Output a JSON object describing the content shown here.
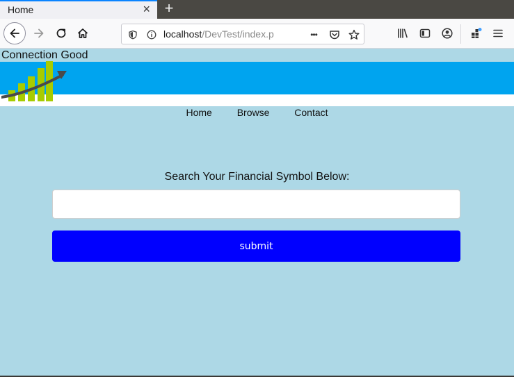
{
  "browser": {
    "tab": {
      "title": "Home",
      "close_symbol": "×"
    },
    "new_tab_symbol": "+",
    "url": {
      "host": "localhost",
      "path": "/DevTest/index.p"
    },
    "url_more_symbol": "•••"
  },
  "page": {
    "connection_status": "Connection Good",
    "nav": [
      "Home",
      "Browse",
      "Contact"
    ],
    "search_prompt": "Search Your Financial Symbol Below:",
    "search_value": "",
    "submit_label": "submit"
  },
  "colors": {
    "page_bg": "#add8e6",
    "banner": "#00a4ef",
    "submit_bg": "#0000ff",
    "logo_bars": "#a8cc00",
    "logo_arrow": "#4a4a4a"
  },
  "icons": [
    "back-arrow-icon",
    "forward-arrow-icon",
    "reload-icon",
    "home-icon",
    "shield-icon",
    "info-icon",
    "pocket-icon",
    "star-icon",
    "library-icon",
    "sidebar-icon",
    "account-icon",
    "extensions-icon",
    "menu-icon"
  ]
}
